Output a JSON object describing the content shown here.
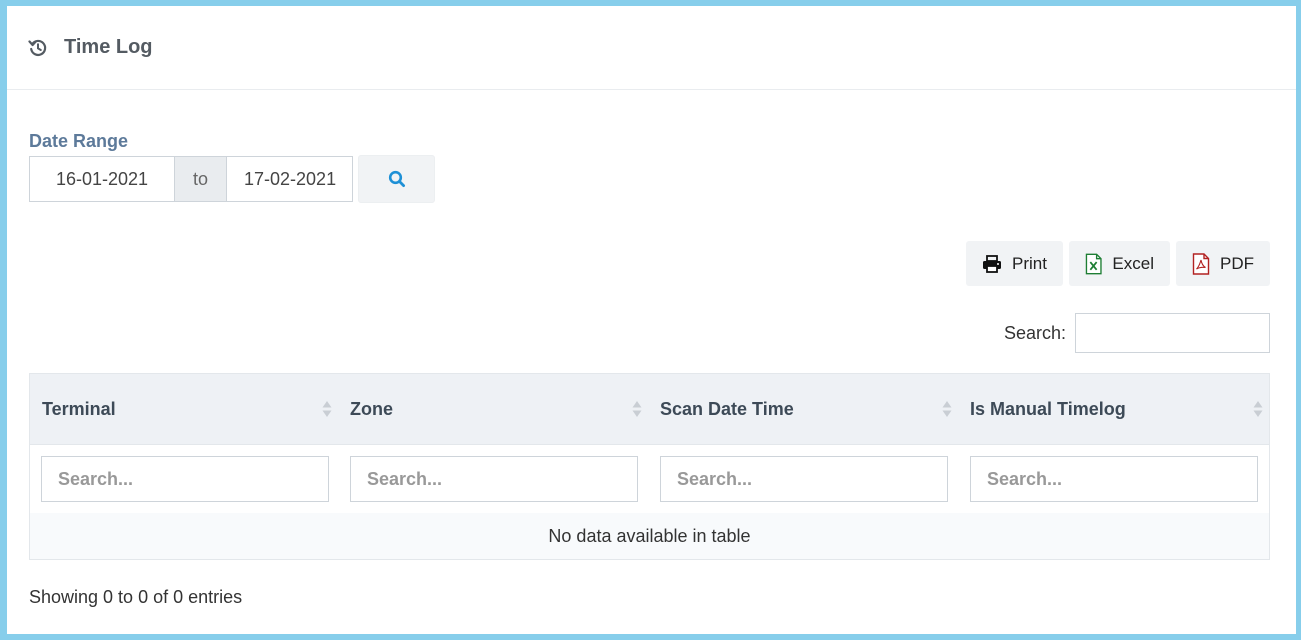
{
  "header": {
    "title": "Time Log",
    "icon": "history-icon"
  },
  "date_range": {
    "label": "Date Range",
    "from_value": "16-01-2021",
    "separator": "to",
    "to_value": "17-02-2021"
  },
  "export_buttons": {
    "print_label": "Print",
    "excel_label": "Excel",
    "pdf_label": "PDF"
  },
  "search": {
    "label": "Search:",
    "value": ""
  },
  "table": {
    "columns": [
      "Terminal",
      "Zone",
      "Scan Date Time",
      "Is Manual Timelog"
    ],
    "filter_placeholder": "Search...",
    "empty_message": "No data available in table"
  },
  "info": {
    "text": "Showing 0 to 0 of 0 entries"
  },
  "colors": {
    "frame_border": "#87ceeb",
    "accent_blue": "#1e90d6",
    "excel_green": "#1e7e34",
    "pdf_red": "#b22222",
    "label_blue": "#5d7a9a"
  }
}
